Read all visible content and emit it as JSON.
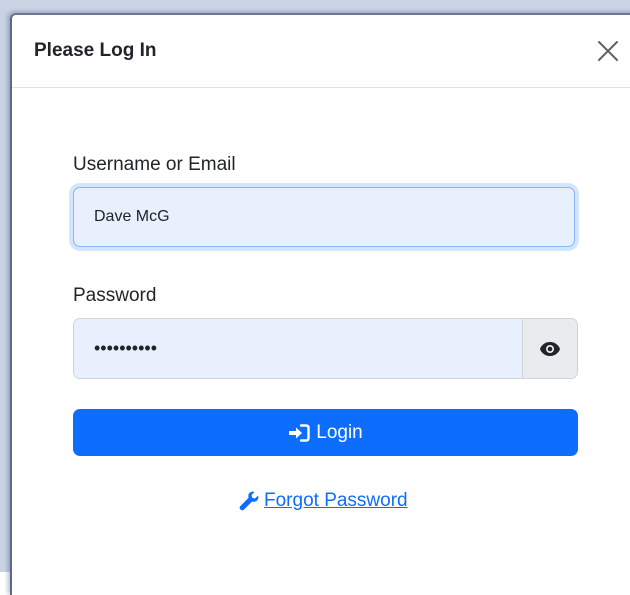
{
  "dialog": {
    "title": "Please Log In",
    "close_icon": "close-icon"
  },
  "form": {
    "username_label": "Username or Email",
    "username_value": "Dave McG",
    "password_label": "Password",
    "password_value": "DaveMcG123",
    "toggle_icon": "eye-icon",
    "login_icon": "sign-in-icon",
    "login_label": "Login",
    "forgot_icon": "wrench-icon",
    "forgot_label": "Forgot Password"
  },
  "colors": {
    "primary": "#0d6efd",
    "input_bg": "#e8f0fe"
  }
}
